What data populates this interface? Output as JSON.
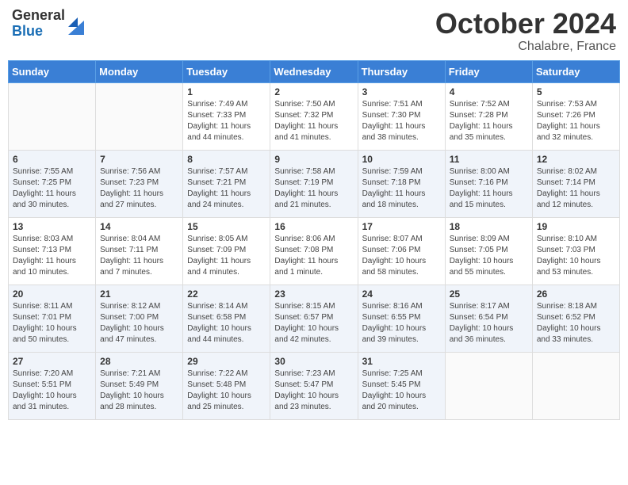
{
  "logo": {
    "general": "General",
    "blue": "Blue"
  },
  "title": "October 2024",
  "location": "Chalabre, France",
  "days_of_week": [
    "Sunday",
    "Monday",
    "Tuesday",
    "Wednesday",
    "Thursday",
    "Friday",
    "Saturday"
  ],
  "weeks": [
    [
      {
        "day": "",
        "info": ""
      },
      {
        "day": "",
        "info": ""
      },
      {
        "day": "1",
        "info": "Sunrise: 7:49 AM\nSunset: 7:33 PM\nDaylight: 11 hours and 44 minutes."
      },
      {
        "day": "2",
        "info": "Sunrise: 7:50 AM\nSunset: 7:32 PM\nDaylight: 11 hours and 41 minutes."
      },
      {
        "day": "3",
        "info": "Sunrise: 7:51 AM\nSunset: 7:30 PM\nDaylight: 11 hours and 38 minutes."
      },
      {
        "day": "4",
        "info": "Sunrise: 7:52 AM\nSunset: 7:28 PM\nDaylight: 11 hours and 35 minutes."
      },
      {
        "day": "5",
        "info": "Sunrise: 7:53 AM\nSunset: 7:26 PM\nDaylight: 11 hours and 32 minutes."
      }
    ],
    [
      {
        "day": "6",
        "info": "Sunrise: 7:55 AM\nSunset: 7:25 PM\nDaylight: 11 hours and 30 minutes."
      },
      {
        "day": "7",
        "info": "Sunrise: 7:56 AM\nSunset: 7:23 PM\nDaylight: 11 hours and 27 minutes."
      },
      {
        "day": "8",
        "info": "Sunrise: 7:57 AM\nSunset: 7:21 PM\nDaylight: 11 hours and 24 minutes."
      },
      {
        "day": "9",
        "info": "Sunrise: 7:58 AM\nSunset: 7:19 PM\nDaylight: 11 hours and 21 minutes."
      },
      {
        "day": "10",
        "info": "Sunrise: 7:59 AM\nSunset: 7:18 PM\nDaylight: 11 hours and 18 minutes."
      },
      {
        "day": "11",
        "info": "Sunrise: 8:00 AM\nSunset: 7:16 PM\nDaylight: 11 hours and 15 minutes."
      },
      {
        "day": "12",
        "info": "Sunrise: 8:02 AM\nSunset: 7:14 PM\nDaylight: 11 hours and 12 minutes."
      }
    ],
    [
      {
        "day": "13",
        "info": "Sunrise: 8:03 AM\nSunset: 7:13 PM\nDaylight: 11 hours and 10 minutes."
      },
      {
        "day": "14",
        "info": "Sunrise: 8:04 AM\nSunset: 7:11 PM\nDaylight: 11 hours and 7 minutes."
      },
      {
        "day": "15",
        "info": "Sunrise: 8:05 AM\nSunset: 7:09 PM\nDaylight: 11 hours and 4 minutes."
      },
      {
        "day": "16",
        "info": "Sunrise: 8:06 AM\nSunset: 7:08 PM\nDaylight: 11 hours and 1 minute."
      },
      {
        "day": "17",
        "info": "Sunrise: 8:07 AM\nSunset: 7:06 PM\nDaylight: 10 hours and 58 minutes."
      },
      {
        "day": "18",
        "info": "Sunrise: 8:09 AM\nSunset: 7:05 PM\nDaylight: 10 hours and 55 minutes."
      },
      {
        "day": "19",
        "info": "Sunrise: 8:10 AM\nSunset: 7:03 PM\nDaylight: 10 hours and 53 minutes."
      }
    ],
    [
      {
        "day": "20",
        "info": "Sunrise: 8:11 AM\nSunset: 7:01 PM\nDaylight: 10 hours and 50 minutes."
      },
      {
        "day": "21",
        "info": "Sunrise: 8:12 AM\nSunset: 7:00 PM\nDaylight: 10 hours and 47 minutes."
      },
      {
        "day": "22",
        "info": "Sunrise: 8:14 AM\nSunset: 6:58 PM\nDaylight: 10 hours and 44 minutes."
      },
      {
        "day": "23",
        "info": "Sunrise: 8:15 AM\nSunset: 6:57 PM\nDaylight: 10 hours and 42 minutes."
      },
      {
        "day": "24",
        "info": "Sunrise: 8:16 AM\nSunset: 6:55 PM\nDaylight: 10 hours and 39 minutes."
      },
      {
        "day": "25",
        "info": "Sunrise: 8:17 AM\nSunset: 6:54 PM\nDaylight: 10 hours and 36 minutes."
      },
      {
        "day": "26",
        "info": "Sunrise: 8:18 AM\nSunset: 6:52 PM\nDaylight: 10 hours and 33 minutes."
      }
    ],
    [
      {
        "day": "27",
        "info": "Sunrise: 7:20 AM\nSunset: 5:51 PM\nDaylight: 10 hours and 31 minutes."
      },
      {
        "day": "28",
        "info": "Sunrise: 7:21 AM\nSunset: 5:49 PM\nDaylight: 10 hours and 28 minutes."
      },
      {
        "day": "29",
        "info": "Sunrise: 7:22 AM\nSunset: 5:48 PM\nDaylight: 10 hours and 25 minutes."
      },
      {
        "day": "30",
        "info": "Sunrise: 7:23 AM\nSunset: 5:47 PM\nDaylight: 10 hours and 23 minutes."
      },
      {
        "day": "31",
        "info": "Sunrise: 7:25 AM\nSunset: 5:45 PM\nDaylight: 10 hours and 20 minutes."
      },
      {
        "day": "",
        "info": ""
      },
      {
        "day": "",
        "info": ""
      }
    ]
  ]
}
